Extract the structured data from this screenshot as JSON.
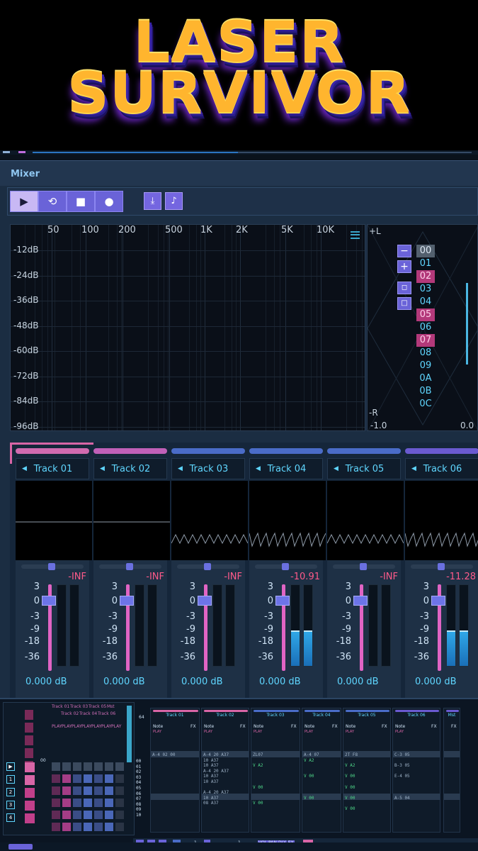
{
  "banner": {
    "line1": "LASER",
    "line2": "SURVIVOR"
  },
  "window": {
    "title": "Mixer"
  },
  "toolbar": {
    "buttons": [
      {
        "icon": "play-icon",
        "glyph": "▶"
      },
      {
        "icon": "loop-icon",
        "glyph": "⟲"
      },
      {
        "icon": "stop-icon",
        "glyph": "■"
      },
      {
        "icon": "record-icon",
        "glyph": "●"
      }
    ],
    "extra": [
      {
        "icon": "bounce-icon",
        "glyph": "⤓"
      },
      {
        "icon": "metronome-icon",
        "glyph": "♪"
      }
    ]
  },
  "analyzer": {
    "freq_labels": [
      "50",
      "100",
      "200",
      "500",
      "1K",
      "2K",
      "5K",
      "10K"
    ],
    "db_labels": [
      "-12dB",
      "-24dB",
      "-36dB",
      "-48dB",
      "-60dB",
      "-72dB",
      "-84dB",
      "-96dB"
    ]
  },
  "goniometer": {
    "top_left": "+L",
    "bottom_left": "-R",
    "axis_min": "-1.0",
    "axis_max": "0.0",
    "minus_glyph": "−",
    "plus_glyph": "+",
    "patterns": [
      "00",
      "01",
      "02",
      "03",
      "04",
      "05",
      "06",
      "07",
      "08",
      "09",
      "0A",
      "0B",
      "0C"
    ],
    "selected": "00",
    "marked": [
      "02",
      "05",
      "07"
    ]
  },
  "mixer": {
    "scale": [
      "3",
      "0",
      "-3",
      "-9",
      "-18",
      "-36"
    ],
    "tracks": [
      {
        "name": "Track 01",
        "color": "#d16bb0",
        "peak": "-INF",
        "gain": "0.000 dB",
        "level": 0
      },
      {
        "name": "Track 02",
        "color": "#c060b8",
        "peak": "-INF",
        "gain": "0.000 dB",
        "level": 0
      },
      {
        "name": "Track 03",
        "color": "#4a6cc8",
        "peak": "-INF",
        "gain": "0.000 dB",
        "level": 0
      },
      {
        "name": "Track 04",
        "color": "#4a6cc8",
        "peak": "-10.91",
        "gain": "0.000 dB",
        "level": 0.42
      },
      {
        "name": "Track 05",
        "color": "#4a6cc8",
        "peak": "-INF",
        "gain": "0.000 dB",
        "level": 0
      },
      {
        "name": "Track 06",
        "color": "#6a5ad0",
        "peak": "-11.28",
        "gain": "0.000 dB",
        "level": 0.42
      }
    ]
  },
  "tracker": {
    "header_tracks": [
      "Track 01",
      "Track 02",
      "Track 03",
      "Track 04",
      "Track 05",
      "Track 06",
      "Mst"
    ],
    "header_play": "PLAY",
    "channels": [
      {
        "name": "Track 01",
        "note": "Note",
        "fx": "FX"
      },
      {
        "name": "Track 02",
        "note": "Note",
        "fx": "FX"
      },
      {
        "name": "Track 03",
        "note": "Note",
        "fx": "FX"
      },
      {
        "name": "Track 04",
        "note": "Note",
        "fx": "FX"
      },
      {
        "name": "Track 05",
        "note": "Note",
        "fx": "FX"
      },
      {
        "name": "Track 06",
        "note": "Note",
        "fx": "FX"
      },
      {
        "name": "Mst",
        "note": "",
        "fx": "FX"
      }
    ],
    "row_numbers": [
      "00",
      "01",
      "02",
      "03",
      "04",
      "05",
      "06",
      "07",
      "08",
      "09",
      "10"
    ],
    "pattern_len": "64",
    "col_rows": [
      [
        "A-4 02 00",
        "",
        "",
        "",
        "",
        "",
        "",
        "",
        "",
        "",
        ""
      ],
      [
        "A-4  20 A37",
        "10 A37",
        "10 A37",
        "A-4  20 A37",
        "10 A37",
        "10 A37",
        "",
        "A-4  20 A37",
        "10 A37",
        "08 A37",
        ""
      ],
      [
        "ZL07",
        "",
        "V A2",
        "",
        "",
        "",
        "V 00",
        "",
        "",
        "V 00",
        ""
      ],
      [
        "A-4 07",
        "V A2",
        "",
        "",
        "V 00",
        "",
        "",
        "",
        "V 00",
        "",
        ""
      ],
      [
        "2T F8",
        "",
        "V A2",
        "",
        "V 00",
        "",
        "V 00",
        "",
        "V 00",
        "",
        "V 00"
      ],
      [
        "C-3 05",
        "",
        "B-3 05",
        "",
        "E-4 05",
        "",
        "",
        "",
        "A-5 04",
        "",
        ""
      ]
    ],
    "bottom_labels": [
      "VOL",
      "PAN",
      "DLY",
      "FX"
    ],
    "octave": "1",
    "step": "1"
  }
}
